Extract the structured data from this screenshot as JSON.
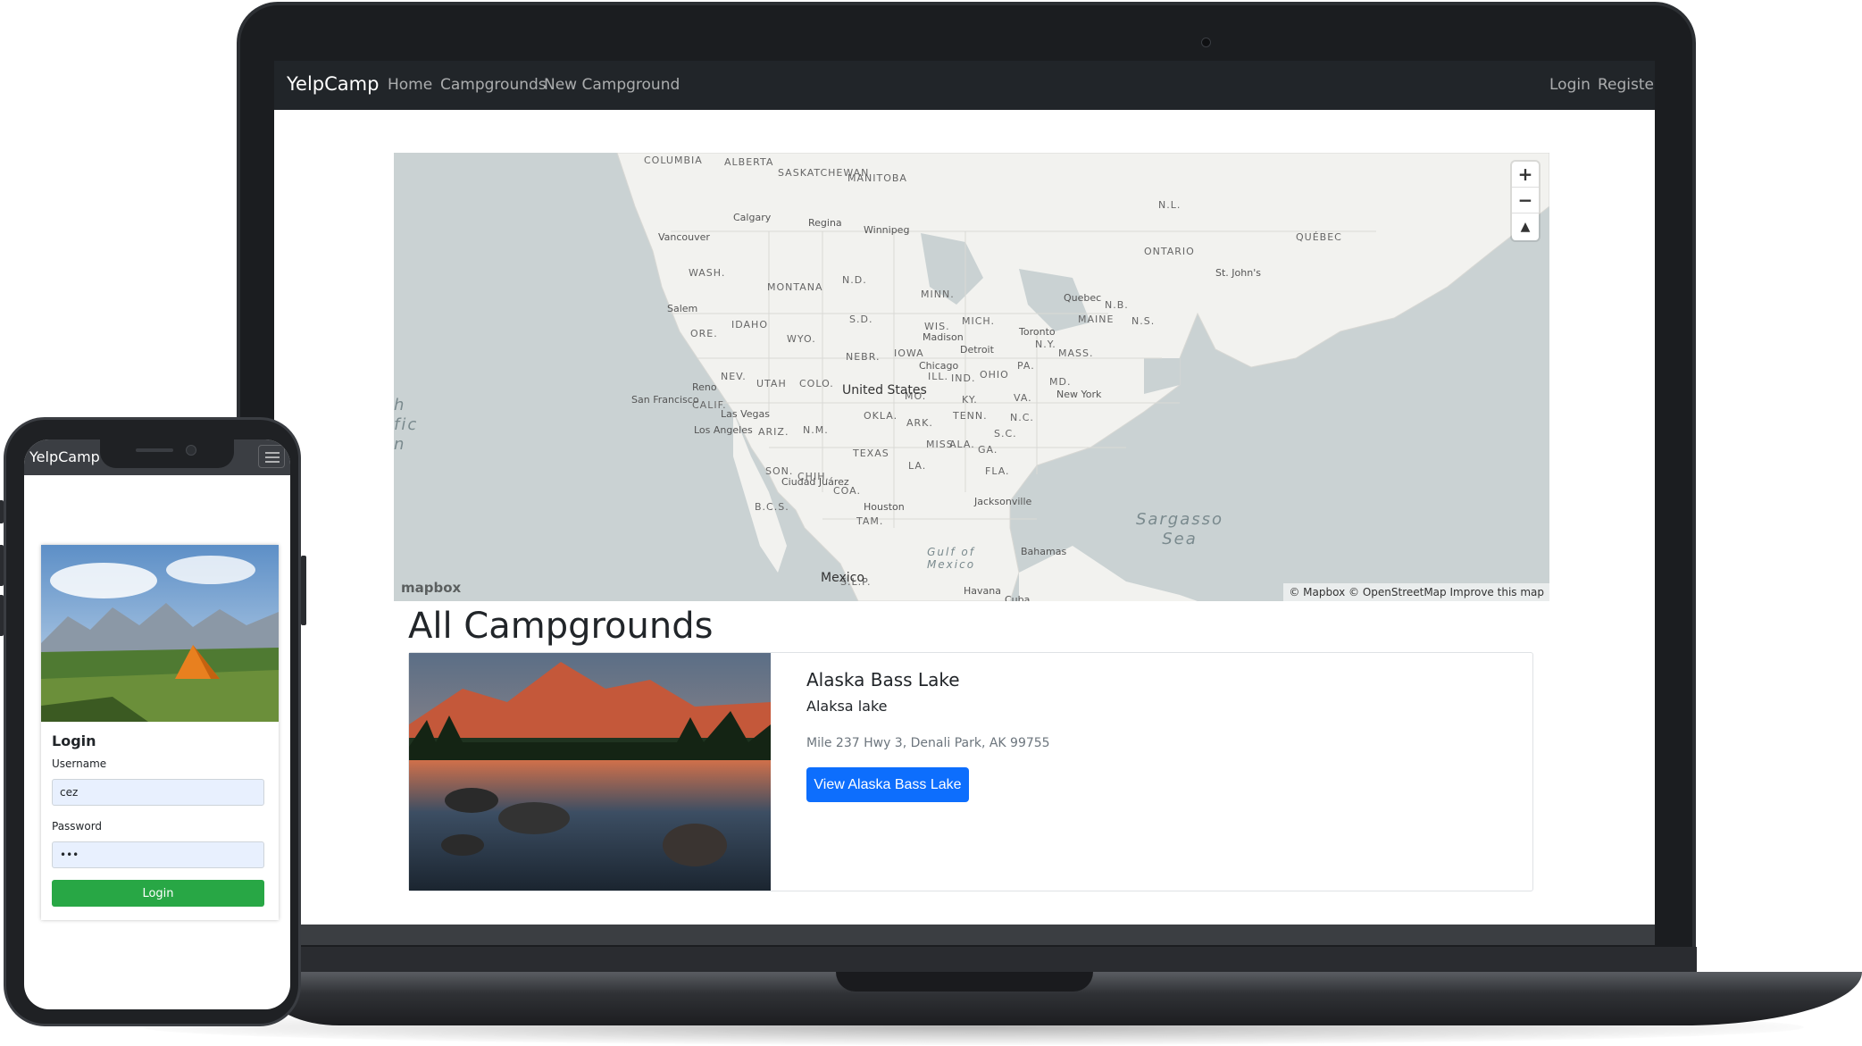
{
  "laptop": {
    "nav": {
      "brand": "YelpCamp",
      "links": [
        "Home",
        "Campgrounds",
        "New Campground"
      ],
      "right_links": [
        "Login",
        "Register"
      ]
    },
    "map": {
      "controls": {
        "zoom_in": "+",
        "zoom_out": "−",
        "compass": "▲"
      },
      "logo": "mapbox",
      "attribution": "© Mapbox © OpenStreetMap Improve this map",
      "country_labels": [
        "United States",
        "Mexico"
      ],
      "region_labels": [
        "COLUMBIA",
        "ALBERTA",
        "SASKATCHEWAN",
        "MANITOBA",
        "ONTARIO",
        "QUÉBEC",
        "WASH.",
        "MONTANA",
        "N.D.",
        "MINN.",
        "IDAHO",
        "ORE.",
        "WYO.",
        "S.D.",
        "NEBR.",
        "IOWA",
        "WIS.",
        "MICH.",
        "NEV.",
        "UTAH",
        "COLO.",
        "CALIF.",
        "ARIZ.",
        "N.M.",
        "OKLA.",
        "ARK.",
        "TEXAS",
        "MISS.",
        "ALA.",
        "GA.",
        "TENN.",
        "KY.",
        "OHIO",
        "PA.",
        "N.Y.",
        "VA.",
        "N.C.",
        "S.C.",
        "FLA.",
        "MAINE",
        "N.B.",
        "N.S.",
        "N.L.",
        "CHIH.",
        "SON.",
        "COA.",
        "MO.",
        "IND.",
        "ILL.",
        "LA.",
        "TAM.",
        "MASS.",
        "MD.",
        "S.L.P.",
        "B.C.S."
      ],
      "city_labels": [
        "Calgary",
        "Regina",
        "Winnipeg",
        "Vancouver",
        "Salem",
        "Reno",
        "San Francisco",
        "Las Vegas",
        "Los Angeles",
        "Ciudad Juárez",
        "Houston",
        "Chicago",
        "Madison",
        "Detroit",
        "Toronto",
        "Quebec",
        "New York",
        "Jacksonville",
        "Bahamas",
        "Havana",
        "Cuba",
        "St. John's"
      ],
      "sea_labels": [
        "Sargasso Sea",
        "Gulf of Mexico"
      ],
      "partial_ocean_label": "h\nfic\nn"
    },
    "heading": "All Campgrounds",
    "campground": {
      "title": "Alaska Bass Lake",
      "description": "Alaksa lake",
      "location": "Mile 237 Hwy 3, Denali Park, AK 99755",
      "button": "View Alaska Bass Lake"
    }
  },
  "phone": {
    "nav": {
      "brand": "YelpCamp",
      "menu_icon": "hamburger-icon"
    },
    "login": {
      "heading": "Login",
      "username_label": "Username",
      "username_value": "cez",
      "password_label": "Password",
      "password_value": "•••",
      "button": "Login"
    }
  },
  "colors": {
    "navbar": "#212529",
    "primary": "#0d6efd",
    "success": "#28a745",
    "map_water": "#cad2d3",
    "map_land": "#f2f2ef"
  }
}
